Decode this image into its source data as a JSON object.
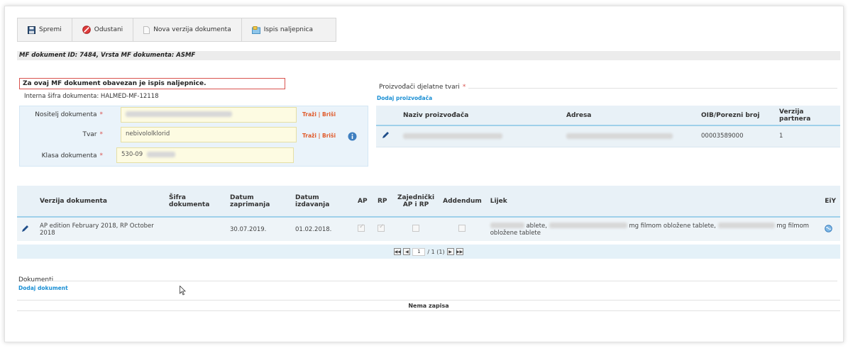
{
  "toolbar": {
    "save_label": "Spremi",
    "cancel_label": "Odustani",
    "new_version_label": "Nova verzija dokumenta",
    "print_label": "Ispis naljepnica"
  },
  "header": {
    "mf_title": "MF dokument ID: 7484, Vrsta MF dokumenta: ASMF"
  },
  "form": {
    "warning": "Za ovaj MF dokument obavezan je ispis naljepnice.",
    "internal_code": "Interna šifra dokumenta: HALMED-MF-12118",
    "holder_label": "Nositelj dokumenta",
    "substance_label": "Tvar",
    "substance_value": "nebivololklorid",
    "class_label": "Klasa dokumenta",
    "class_value": "530-09",
    "search_link": "Traži",
    "sep": "|",
    "delete_link": "Briši",
    "required_mark": "*"
  },
  "producers": {
    "title": "Proizvođači djelatne tvari",
    "add_link": "Dodaj proizvođača",
    "columns": [
      "Naziv proizvođača",
      "Adresa",
      "OIB/Porezni broj",
      "Verzija partnera"
    ],
    "rows": [
      {
        "oib": "00003589000",
        "version": "1"
      }
    ]
  },
  "versions": {
    "columns": {
      "version": "Verzija dokumenta",
      "code": "Šifra dokumenta",
      "received": "Datum zaprimanja",
      "issued": "Datum izdavanja",
      "ap": "AP",
      "rp": "RP",
      "joint": "Zajednički AP i RP",
      "addendum": "Addendum",
      "drug": "Lijek",
      "eiy": "EiY"
    },
    "rows": [
      {
        "version": "AP edition February 2018, RP October 2018",
        "code": "",
        "received": "30.07.2019.",
        "issued": "01.02.2018.",
        "drug_part1": "ablete,",
        "drug_part2": "mg filmom obložene tablete,",
        "drug_part3": "mg filmom",
        "drug_part4": "obložene tablete"
      }
    ],
    "pager": {
      "current": "1",
      "total": "/ 1 (1)"
    }
  },
  "documents": {
    "title": "Dokumenti",
    "add_link": "Dodaj dokument",
    "empty": "Nema zapisa"
  }
}
